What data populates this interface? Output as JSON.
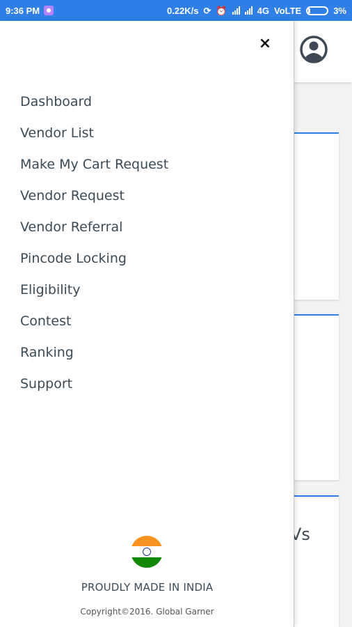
{
  "status_bar": {
    "time": "9:36 PM",
    "speed": "0.22K/s",
    "network": "4G",
    "volte": "VoLTE",
    "battery": "3%",
    "icons": [
      "app-notification-icon",
      "sync-icon",
      "alarm-icon",
      "signal-icon",
      "signal-icon",
      "battery-icon"
    ]
  },
  "drawer": {
    "close_icon": "×",
    "menu_items": [
      {
        "label": "Dashboard"
      },
      {
        "label": "Vendor List"
      },
      {
        "label": "Make My Cart Request"
      },
      {
        "label": "Vendor Request"
      },
      {
        "label": "Vendor Referral"
      },
      {
        "label": "Pincode Locking"
      },
      {
        "label": "Eligibility"
      },
      {
        "label": "Contest"
      },
      {
        "label": "Ranking"
      },
      {
        "label": "Support"
      }
    ],
    "tagline": "PROUDLY MADE IN INDIA",
    "copyright": "Copyright©2016. Global Garner"
  },
  "background": {
    "card3_fragment": "Vs"
  },
  "colors": {
    "accent": "#2f7fe6",
    "text": "#3a4a57"
  }
}
